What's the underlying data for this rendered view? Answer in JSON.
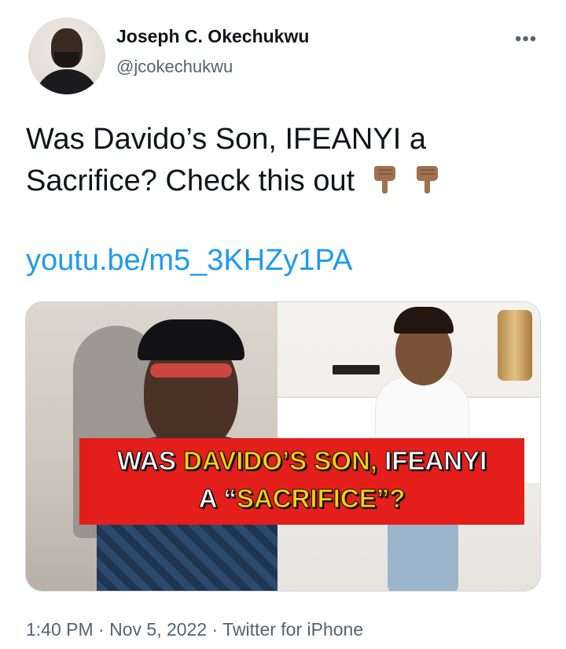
{
  "author": {
    "name": "Joseph C. Okechukwu",
    "handle": "@jcokechukwu"
  },
  "more_icon": "more-horizontal-icon",
  "tweet": {
    "text": "Was Davido’s Son, IFEANYI a Sacrifice? Check this out",
    "emoji": "backhand-index-pointing-down-medium-dark-skin",
    "link": "youtu.be/m5_3KHZy1PA"
  },
  "media": {
    "banner": {
      "line1_white": "WAS ",
      "line1_yellow": "DAVIDO’S SON, ",
      "line1_white2": "IFEANYI",
      "line2_white": "A ",
      "line2_quote_open": "“",
      "line2_yellow": "SACRIFICE",
      "line2_quote_close": "”?",
      "colors": {
        "background": "#e41e1b",
        "yellow": "#f5d20a",
        "white": "#ffffff"
      }
    }
  },
  "footer": {
    "time": "1:40 PM",
    "sep1": " · ",
    "date": "Nov 5, 2022",
    "sep2": " · ",
    "source": "Twitter for iPhone"
  },
  "colors": {
    "link": "#1d9bf0",
    "secondary_text": "#536471",
    "primary_text": "#0f1419"
  }
}
